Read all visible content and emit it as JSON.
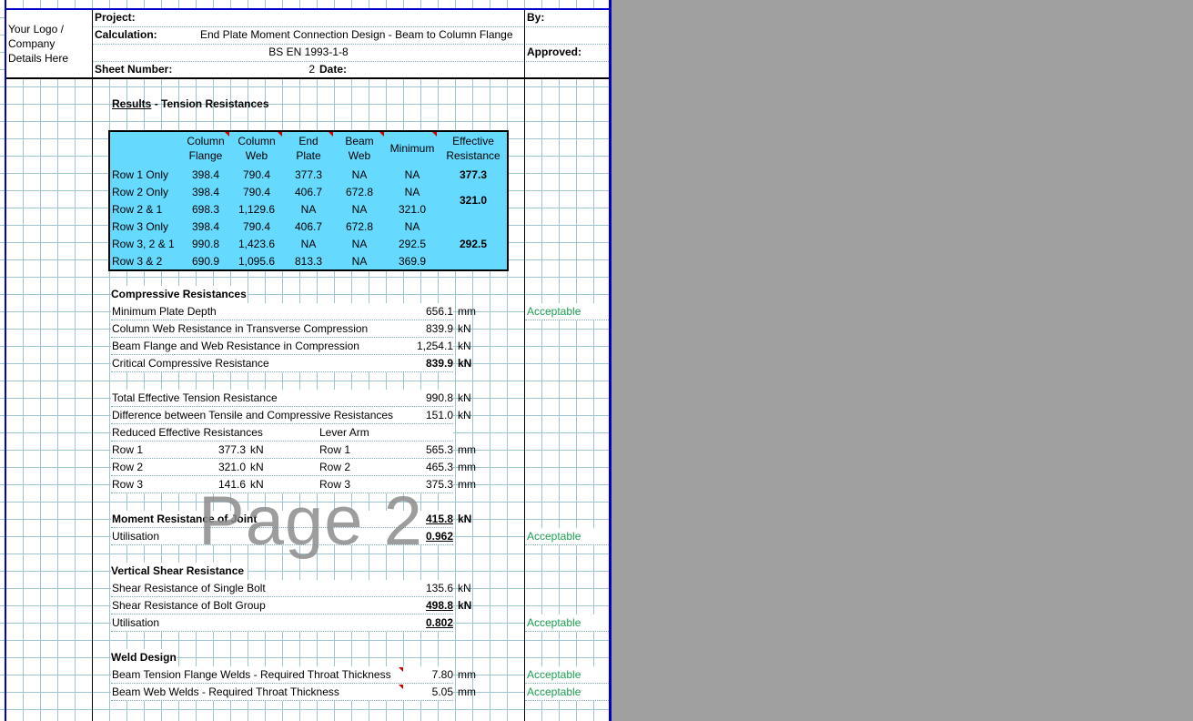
{
  "header": {
    "logo_text": [
      "Your Logo /",
      "Company",
      "Details Here"
    ],
    "project_label": "Project:",
    "by_label": "By:",
    "calculation_label": "Calculation:",
    "calculation_value": "End Plate Moment Connection Design - Beam to Column Flange",
    "standard": "BS EN 1993-1-8",
    "approved_label": "Approved:",
    "sheet_number_label": "Sheet Number:",
    "sheet_number_value": "2",
    "date_label": "Date:"
  },
  "tension": {
    "title_underlined": "Results",
    "title_rest": " - Tension Resistances",
    "columns": [
      [
        "Column",
        "Flange"
      ],
      [
        "Column",
        "Web"
      ],
      [
        "End",
        "Plate"
      ],
      [
        "Beam",
        "Web"
      ],
      [
        "Minimum"
      ],
      [
        "Effective",
        "Resistance"
      ]
    ],
    "rows": [
      {
        "label": "Row 1 Only",
        "cf": "398.4",
        "cw": "790.4",
        "ep": "377.3",
        "bw": "NA",
        "min": "NA"
      },
      {
        "label": "Row 2 Only",
        "cf": "398.4",
        "cw": "790.4",
        "ep": "406.7",
        "bw": "672.8",
        "min": "NA"
      },
      {
        "label": "Row 2 & 1",
        "cf": "698.3",
        "cw": "1,129.6",
        "ep": "NA",
        "bw": "NA",
        "min": "321.0"
      },
      {
        "label": "Row 3 Only",
        "cf": "398.4",
        "cw": "790.4",
        "ep": "406.7",
        "bw": "672.8",
        "min": "NA"
      },
      {
        "label": "Row 3, 2 & 1",
        "cf": "990.8",
        "cw": "1,423.6",
        "ep": "NA",
        "bw": "NA",
        "min": "292.5"
      },
      {
        "label": "Row 3 & 2",
        "cf": "690.9",
        "cw": "1,095.6",
        "ep": "813.3",
        "bw": "NA",
        "min": "369.9"
      }
    ],
    "effective": [
      "377.3",
      "321.0",
      "292.5"
    ]
  },
  "compressive": {
    "title": "Compressive Resistances",
    "items": [
      {
        "label": "Minimum Plate Depth",
        "value": "656.1",
        "unit": "mm",
        "status": "Acceptable"
      },
      {
        "label": "Column Web Resistance in Transverse Compression",
        "value": "839.9",
        "unit": "kN"
      },
      {
        "label": "Beam Flange and Web Resistance in Compression",
        "value": "1,254.1",
        "unit": "kN"
      },
      {
        "label": "Critical Compressive Resistance",
        "value": "839.9",
        "unit": "kN"
      }
    ]
  },
  "totals": {
    "total_label": "Total Effective Tension Resistance",
    "total_value": "990.8",
    "total_unit": "kN",
    "diff_label": "Difference between Tensile and Compressive Resistances",
    "diff_value": "151.0",
    "diff_unit": "kN"
  },
  "reduced": {
    "title": "Reduced Effective Resistances",
    "rows": [
      {
        "label": "Row 1",
        "value": "377.3",
        "unit": "kN"
      },
      {
        "label": "Row 2",
        "value": "321.0",
        "unit": "kN"
      },
      {
        "label": "Row 3",
        "value": "141.6",
        "unit": "kN"
      }
    ]
  },
  "lever": {
    "title": "Lever Arm",
    "rows": [
      {
        "label": "Row 1",
        "value": "565.3",
        "unit": "mm"
      },
      {
        "label": "Row 2",
        "value": "465.3",
        "unit": "mm"
      },
      {
        "label": "Row 3",
        "value": "375.3",
        "unit": "mm"
      }
    ]
  },
  "moment": {
    "label": "Moment Resistance of Joint",
    "value": "415.8",
    "unit": "kN",
    "util_label": "Utilisation",
    "util_value": "0.962",
    "status": "Acceptable"
  },
  "shear": {
    "title": "Vertical Shear Resistance",
    "single_label": "Shear Resistance of Single Bolt",
    "single_value": "135.6",
    "single_unit": "kN",
    "group_label": "Shear Resistance of Bolt Group",
    "group_value": "498.8",
    "group_unit": "kN",
    "util_label": "Utilisation",
    "util_value": "0.802",
    "status": "Acceptable"
  },
  "weld": {
    "title": "Weld Design",
    "flange_label": "Beam Tension Flange Welds - Required Throat Thickness",
    "flange_value": "7.80",
    "flange_unit": "mm",
    "flange_status": "Acceptable",
    "web_label": "Beam Web Welds - Required Throat Thickness",
    "web_value": "5.05",
    "web_unit": "mm",
    "web_status": "Acceptable"
  },
  "watermark": "Page 2"
}
